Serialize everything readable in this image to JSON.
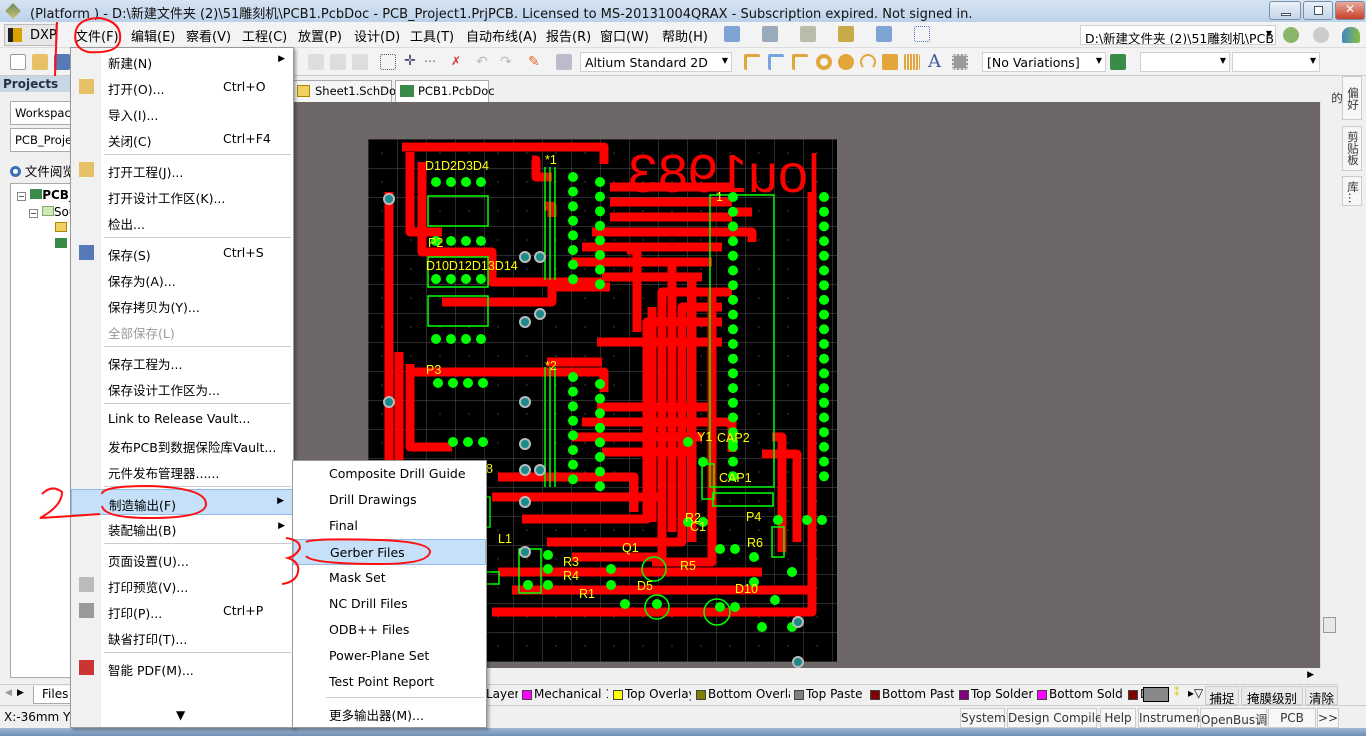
{
  "title": "(Platform ) - D:\\新建文件夹 (2)\\51雕刻机\\PCB1.PcbDoc - PCB_Project1.PrjPCB. Licensed to MS-20131004QRAX - Subscription expired. Not signed in.",
  "menubar": {
    "dxp": "DXP",
    "items": [
      "文件(F)",
      "编辑(E)",
      "察看(V)",
      "工程(C)",
      "放置(P)",
      "设计(D)",
      "工具(T)",
      "自动布线(A)",
      "报告(R)",
      "窗口(W)",
      "帮助(H)"
    ],
    "address": "D:\\新建文件夹 (2)\\51雕刻机\\PCB1.PcbDoc"
  },
  "toolbar": {
    "view_mode": "Altium Standard 2D",
    "variations": "[No Variations]",
    "combo3": "",
    "combo4": ""
  },
  "left_panel": {
    "header": "Projects",
    "workspace": "Workspace",
    "project": "PCB_Project1.PrjPCB",
    "radio_label": "文件阅览",
    "tree": [
      "PCB_Project1.PrjPCB",
      "Source Documents"
    ],
    "tab_files": "Files"
  },
  "doc_tabs": [
    "Sheet1.SchDoc",
    "PCB1.PcbDoc"
  ],
  "right_tabs": [
    "偏好的",
    "剪贴板",
    "库..."
  ],
  "file_menu": [
    {
      "label": "新建(N)",
      "submenu": true
    },
    {
      "label": "打开(O)...",
      "shortcut": "Ctrl+O",
      "icon": "folder-open-icon"
    },
    {
      "label": "导入(I)..."
    },
    {
      "label": "关闭(C)",
      "shortcut": "Ctrl+F4"
    },
    {
      "sep": true
    },
    {
      "label": "打开工程(J)...",
      "icon": "open-project-icon"
    },
    {
      "label": "打开设计工作区(K)..."
    },
    {
      "label": "检出..."
    },
    {
      "sep": true
    },
    {
      "label": "保存(S)",
      "shortcut": "Ctrl+S",
      "icon": "save-icon"
    },
    {
      "label": "保存为(A)..."
    },
    {
      "label": "保存拷贝为(Y)..."
    },
    {
      "label": "全部保存(L)",
      "disabled": true
    },
    {
      "sep": true
    },
    {
      "label": "保存工程为..."
    },
    {
      "label": "保存设计工作区为..."
    },
    {
      "sep": true
    },
    {
      "label": "Link to Release Vault..."
    },
    {
      "label": "发布PCB到数据保险库Vault..."
    },
    {
      "label": "元件发布管理器......"
    },
    {
      "sep": true
    },
    {
      "label": "制造输出(F)",
      "submenu": true,
      "highlighted": true
    },
    {
      "label": "装配输出(B)",
      "submenu": true
    },
    {
      "sep": true
    },
    {
      "label": "页面设置(U)..."
    },
    {
      "label": "打印预览(V)...",
      "icon": "print-preview-icon"
    },
    {
      "label": "打印(P)...",
      "shortcut": "Ctrl+P",
      "icon": "printer-icon"
    },
    {
      "label": "缺省打印(T)..."
    },
    {
      "sep": true
    },
    {
      "label": "智能 PDF(M)...",
      "icon": "pdf-icon"
    }
  ],
  "fab_submenu": [
    {
      "label": "Composite Drill Guide"
    },
    {
      "label": "Drill Drawings"
    },
    {
      "label": "Final"
    },
    {
      "label": "Gerber Files",
      "highlighted": true
    },
    {
      "label": "Mask Set"
    },
    {
      "label": "NC Drill Files"
    },
    {
      "label": "ODB++ Files"
    },
    {
      "label": "Power-Plane Set"
    },
    {
      "label": "Test Point Report"
    },
    {
      "sep": true
    },
    {
      "label": "更多输出器(M)..."
    }
  ],
  "pcb": {
    "board_text": "lou1983",
    "labels": [
      "D1D2D3D4",
      "P2",
      "D10D12D13D14",
      "P3",
      "*1",
      "*2",
      "1",
      "Y1",
      "CAP2",
      "CAP1",
      "R2",
      "C1",
      "R5",
      "P4",
      "R6",
      "D10",
      "Q1",
      "R3",
      "R4",
      "R1",
      "D5",
      "L1",
      "8"
    ]
  },
  "layer_tabs": [
    {
      "label": "Layer",
      "color": ""
    },
    {
      "label": "Mechanical 1",
      "color": "#ff00ff"
    },
    {
      "label": "Top Overlay",
      "color": "#ffff00"
    },
    {
      "label": "Bottom Overlay",
      "color": "#808000"
    },
    {
      "label": "Top Paste",
      "color": "#808080"
    },
    {
      "label": "Bottom Paste",
      "color": "#800000"
    },
    {
      "label": "Top Solder",
      "color": "#800080"
    },
    {
      "label": "Bottom Solder",
      "color": "#ff00ff"
    },
    {
      "label": "D",
      "color": "#800000"
    }
  ],
  "layer_buttons": [
    "捕捉",
    "掩膜级别",
    "清除"
  ],
  "status": {
    "coords": "X:-36mm Y:10",
    "panels": [
      "System",
      "Design Compiler",
      "Help",
      "Instruments",
      "OpenBus调色板",
      "PCB",
      ">>"
    ]
  },
  "annotations": [
    "1",
    "2",
    "3"
  ]
}
